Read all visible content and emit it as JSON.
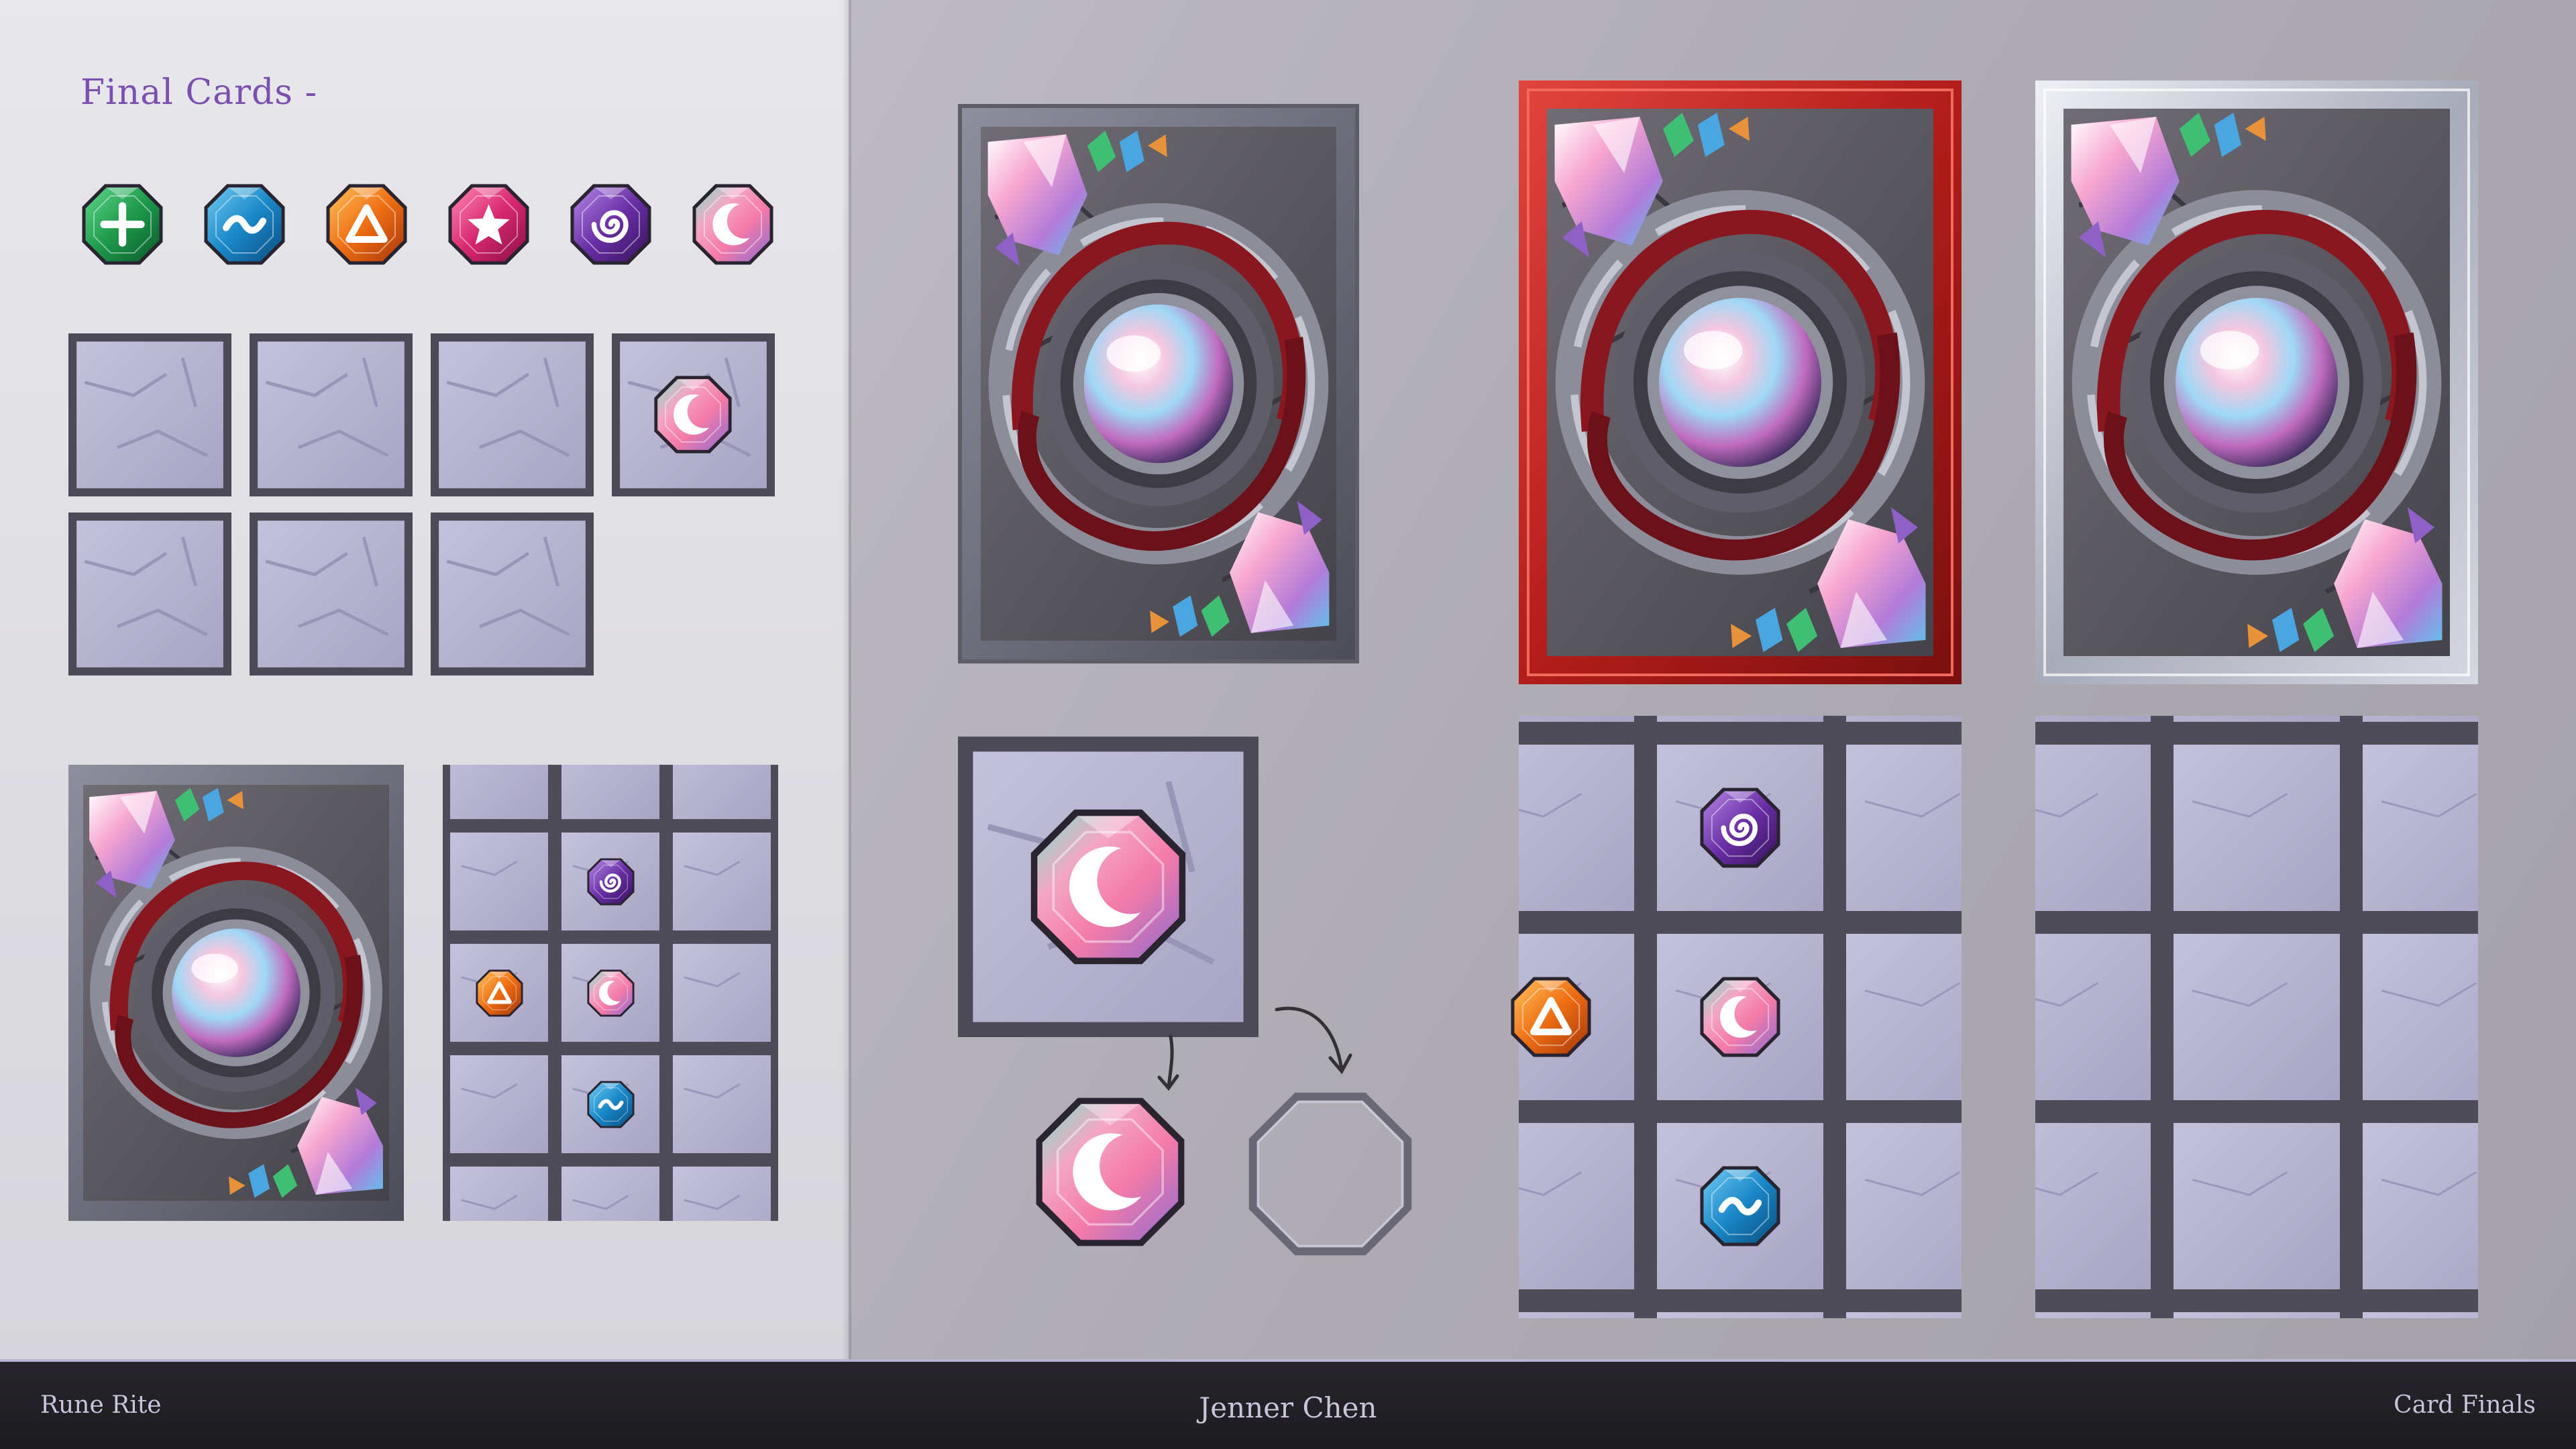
{
  "heading": "Final Cards -",
  "footer": {
    "left": "Rune Rite",
    "center": "Jenner Chen",
    "right": "Card Finals"
  },
  "runes": [
    {
      "name": "plus",
      "color": "#1e9a4c",
      "icon": "plus-rune-icon"
    },
    {
      "name": "wave",
      "color": "#1a88c8",
      "icon": "wave-rune-icon"
    },
    {
      "name": "triangle",
      "color": "#ee6d12",
      "icon": "triangle-rune-icon"
    },
    {
      "name": "star",
      "color": "#d8286f",
      "icon": "star-rune-icon"
    },
    {
      "name": "spiral",
      "color": "#6a2fa6",
      "icon": "spiral-rune-icon"
    },
    {
      "name": "moon",
      "color": "#f3a6c4",
      "icon": "moon-rune-icon"
    }
  ],
  "colors": {
    "tile": "#b6b3d0",
    "tile_frame": "#4d4a58",
    "card_frame_red": "#c0231f",
    "card_frame_silver": "#c9ccd6",
    "accent_purple": "#7a4fb0"
  },
  "board_grid": {
    "rows": 3,
    "cols": 3,
    "pieces": [
      {
        "row": 0,
        "col": 1,
        "rune": "spiral"
      },
      {
        "row": 1,
        "col": 0,
        "rune": "triangle"
      },
      {
        "row": 1,
        "col": 1,
        "rune": "moon"
      },
      {
        "row": 2,
        "col": 1,
        "rune": "wave"
      }
    ]
  }
}
